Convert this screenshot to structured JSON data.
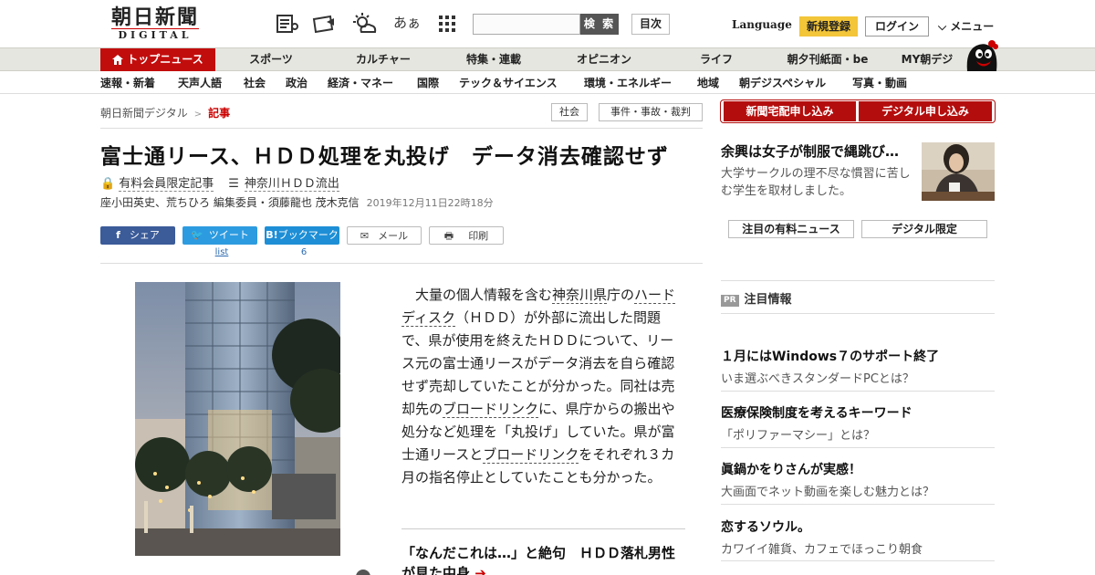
{
  "header": {
    "logo_main": "朝日新聞",
    "logo_sub": "DIGITAL",
    "font_size_label": "あぁ",
    "search": {
      "placeholder": "",
      "button": "検 索"
    },
    "toc": "目次",
    "language": "Language",
    "register": "新規登録",
    "login": "ログイン",
    "menu": "メニュー"
  },
  "main_nav": [
    "トップニュース",
    "スポーツ",
    "カルチャー",
    "特集・連載",
    "オピニオン",
    "ライフ",
    "朝夕刊紙面・be",
    "MY朝デジ"
  ],
  "sub_nav": [
    "速報・新着",
    "天声人語",
    "社会",
    "政治",
    "経済・マネー",
    "国際",
    "テック＆サイエンス",
    "環境・エネルギー",
    "地域",
    "朝デジスペシャル",
    "写真・動画"
  ],
  "breadcrumb": {
    "home": "朝日新聞デジタル",
    "current": "記事"
  },
  "category_tags": [
    "社会",
    "事件・事故・裁判"
  ],
  "cta": {
    "paper": "新聞宅配申し込み",
    "digital": "デジタル申し込み"
  },
  "article": {
    "headline": "富士通リース、ＨＤＤ処理を丸投げ　データ消去確認せず",
    "member_label": "有料会員限定記事",
    "series_label": "神奈川ＨＤＤ流出",
    "authors": "座小田英史、荒ちひろ 編集委員・須藤龍也 茂木克信",
    "date": "2019年12月11日22時18分",
    "share": {
      "facebook": "シェア",
      "twitter": "ツイート",
      "twitter_count": "list",
      "hatena": "ブックマーク",
      "hatena_count": "6",
      "mail": "メール",
      "print": "印刷"
    },
    "body": {
      "s1": "大量の個人情報を含む",
      "k1": "神奈川県",
      "s2": "庁の",
      "k2": "ハードディスク",
      "s3": "（ＨＤＤ）が外部に流出した問題で、県が使用を終えたＨＤＤについて、リース元の富士通リースがデータ消去を自ら確認せず売却していたことが分かった。同社は売却先の",
      "k3": "ブロードリンク",
      "s4": "に、県庁からの搬出や処分など処理を「丸投げ」していた。県が富士通リースと",
      "k4": "ブロードリンク",
      "s5": "をそれぞれ３カ月の指名停止としていたことも分かった。"
    },
    "related": "「なんだこれは…」と絶句　ＨＤＤ落札男性が見た中身"
  },
  "sidebar": {
    "promo_title": "余興は女子が制服で縄跳び…",
    "promo_desc": "大学サークルの理不尽な慣習に苦しむ学生を取材しました。",
    "tabs": [
      "注目の有料ニュース",
      "デジタル限定"
    ],
    "pr_badge": "PR",
    "pr_heading": "注目情報",
    "pr_items": [
      {
        "title": "１月にはWindows７のサポート終了",
        "sub": "いま選ぶべきスタンダードPCとは？"
      },
      {
        "title": "医療保険制度を考えるキーワード",
        "sub": "「ポリファーマシー」とは？"
      },
      {
        "title": "眞鍋かをりさんが実感！",
        "sub": "大画面でネット動画を楽しむ魅力とは？"
      },
      {
        "title": "恋するソウル。",
        "sub": "カワイイ雑貨、カフェでほっこり朝食"
      }
    ]
  },
  "colors": {
    "brand_red": "#c20d0d",
    "register_yellow": "#f3c539",
    "facebook": "#3b5b99",
    "twitter": "#2d9be0",
    "hatena": "#1e8fd6"
  }
}
